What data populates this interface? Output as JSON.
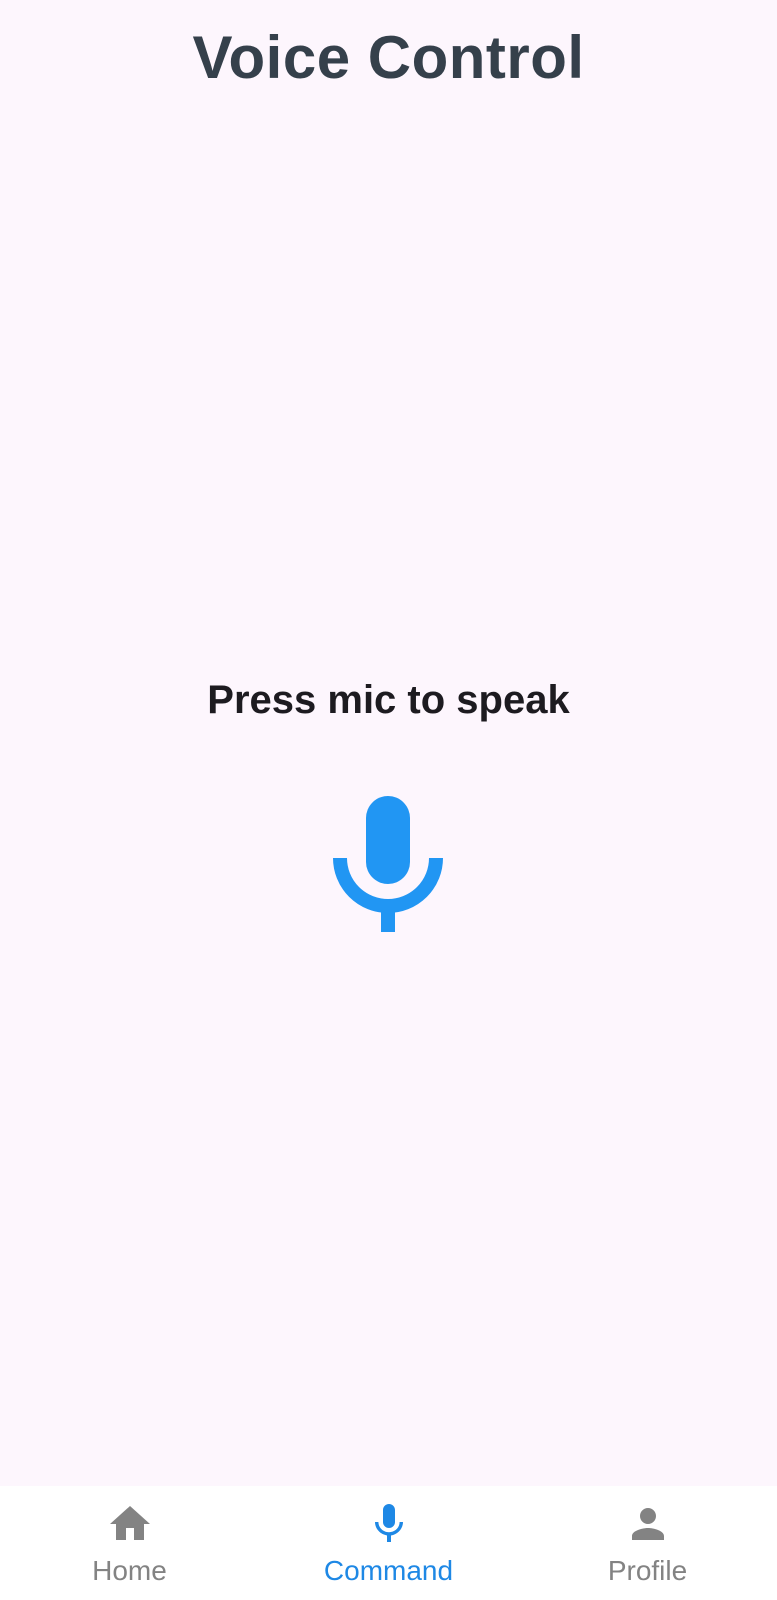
{
  "header": {
    "title": "Voice Control"
  },
  "main": {
    "prompt": "Press mic to speak",
    "mic_icon": "mic-icon"
  },
  "bottom_nav": {
    "items": [
      {
        "label": "Home",
        "icon": "home-icon",
        "active": false
      },
      {
        "label": "Command",
        "icon": "mic-icon",
        "active": true
      },
      {
        "label": "Profile",
        "icon": "person-icon",
        "active": false
      }
    ]
  },
  "colors": {
    "background": "#fdf6fd",
    "title": "#35404b",
    "prompt": "#1d1b20",
    "accent": "#2196f3",
    "nav_active": "#1e88e5",
    "nav_inactive": "#838383"
  }
}
